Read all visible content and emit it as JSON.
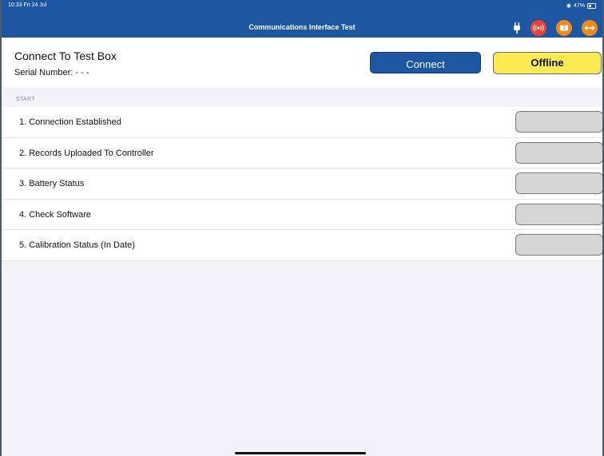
{
  "status_bar": {
    "time_date": "10:33  Fri 24 Jul",
    "battery_text": "47%"
  },
  "navbar": {
    "title": "Communications Interface Test",
    "icons": [
      "plug-icon",
      "broadcast-icon",
      "book-icon",
      "swap-icon"
    ],
    "colors": {
      "bar": "#1d56a1",
      "red": "#e8443a",
      "orange": "#f28a1b"
    }
  },
  "header": {
    "title": "Connect To Test Box",
    "serial_label": "Serial Number: - - -",
    "connect_label": "Connect",
    "offline_label": "Offline",
    "offline_color": "#fdeb55"
  },
  "section": {
    "label": "START"
  },
  "steps": [
    {
      "label": "1. Connection Established"
    },
    {
      "label": "2. Records Uploaded To Controller"
    },
    {
      "label": "3. Battery Status"
    },
    {
      "label": "4. Check Software"
    },
    {
      "label": "5. Calibration Status (In Date)"
    }
  ]
}
